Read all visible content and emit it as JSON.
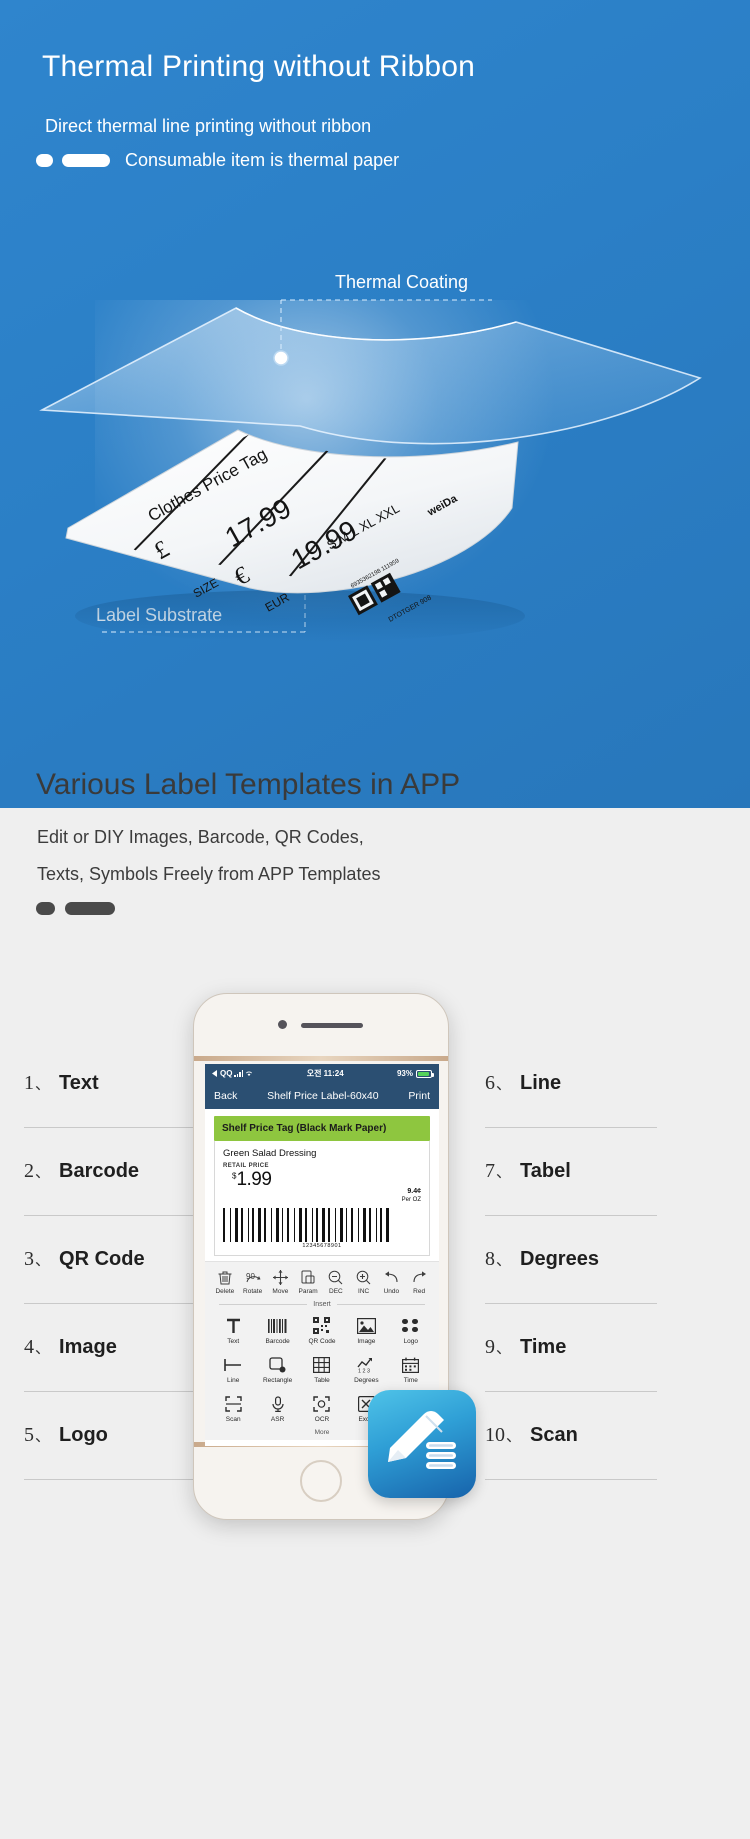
{
  "hero": {
    "title": "Thermal Printing without Ribbon",
    "subtitle": "Direct thermal line printing without ribbon",
    "bullet_text": "Consumable item is thermal paper",
    "callout_coating": "Thermal Coating",
    "callout_substrate": "Label Substrate",
    "bg_color": "#2b80ca",
    "label": {
      "title": "Clothes Price Tag",
      "currency_gbp": "£",
      "price_gbp": "17.99",
      "currency_eur": "€",
      "price_eur": "19.99",
      "size_label": "SIZE",
      "eur_label": "EUR",
      "sizes": "S M L XL XXL",
      "brand": "weiDa",
      "barcode_number": "6935362198 111959",
      "code_text": "DTOTGER 908"
    }
  },
  "section2": {
    "title": "Various Label Templates in APP",
    "line1": "Edit or DIY Images, Barcode, QR Codes,",
    "line2": "Texts, Symbols Freely from APP Templates"
  },
  "features_left": [
    {
      "num": "1",
      "sep": "、",
      "label": "Text"
    },
    {
      "num": "2",
      "sep": "、",
      "label": "Barcode"
    },
    {
      "num": "3",
      "sep": "、",
      "label": "QR Code"
    },
    {
      "num": "4",
      "sep": "、",
      "label": "Image"
    },
    {
      "num": "5",
      "sep": "、",
      "label": "Logo"
    }
  ],
  "features_right": [
    {
      "num": "6",
      "sep": "、",
      "label": "Line"
    },
    {
      "num": "7",
      "sep": "、",
      "label": "Tabel"
    },
    {
      "num": "8",
      "sep": "、",
      "label": "Degrees"
    },
    {
      "num": "9",
      "sep": "、",
      "label": "Time"
    },
    {
      "num": "10",
      "sep": "、",
      "label": "Scan"
    }
  ],
  "phone": {
    "statusbar": {
      "carrier": "QQ",
      "time": "오전 11:24",
      "battery_percent": "93%"
    },
    "navbar": {
      "back": "Back",
      "title": "Shelf Price Label-60x40",
      "print": "Print"
    },
    "label_preview": {
      "banner": "Shelf Price Tag (Black Mark Paper)",
      "banner_color": "#8ec63f",
      "product_name": "Green Salad Dressing",
      "retail_price_label": "RETAIL PRICE",
      "currency": "$",
      "price": "1.99",
      "unit_price": "9.4¢",
      "unit_label": "Per OZ",
      "barcode_number": "12345678901"
    },
    "toolbar": [
      {
        "icon": "trash-icon",
        "label": "Delete"
      },
      {
        "icon": "rotate-icon",
        "label": "Rotate"
      },
      {
        "icon": "move-icon",
        "label": "Move"
      },
      {
        "icon": "param-icon",
        "label": "Param"
      },
      {
        "icon": "zoom-out-icon",
        "label": "DEC"
      },
      {
        "icon": "zoom-in-icon",
        "label": "INC"
      },
      {
        "icon": "undo-icon",
        "label": "Undo"
      },
      {
        "icon": "redo-icon",
        "label": "Red"
      }
    ],
    "insert_divider": "Insert",
    "insert_grid": [
      {
        "icon": "text-icon",
        "label": "Text"
      },
      {
        "icon": "barcode-icon",
        "label": "Barcode"
      },
      {
        "icon": "qrcode-icon",
        "label": "QR Code"
      },
      {
        "icon": "image-icon",
        "label": "Image"
      },
      {
        "icon": "logo-icon",
        "label": "Logo"
      },
      {
        "icon": "line-icon",
        "label": "Line"
      },
      {
        "icon": "rectangle-icon",
        "label": "Rectangle"
      },
      {
        "icon": "table-icon",
        "label": "Table"
      },
      {
        "icon": "degrees-icon",
        "label": "Degrees"
      },
      {
        "icon": "time-icon",
        "label": "Time"
      },
      {
        "icon": "scan-icon",
        "label": "Scan"
      },
      {
        "icon": "asr-icon",
        "label": "ASR"
      },
      {
        "icon": "ocr-icon",
        "label": "OCR"
      },
      {
        "icon": "excel-icon",
        "label": "Excel"
      },
      {
        "icon": "tlogo-icon",
        "label": ""
      }
    ],
    "more_label": "More"
  }
}
